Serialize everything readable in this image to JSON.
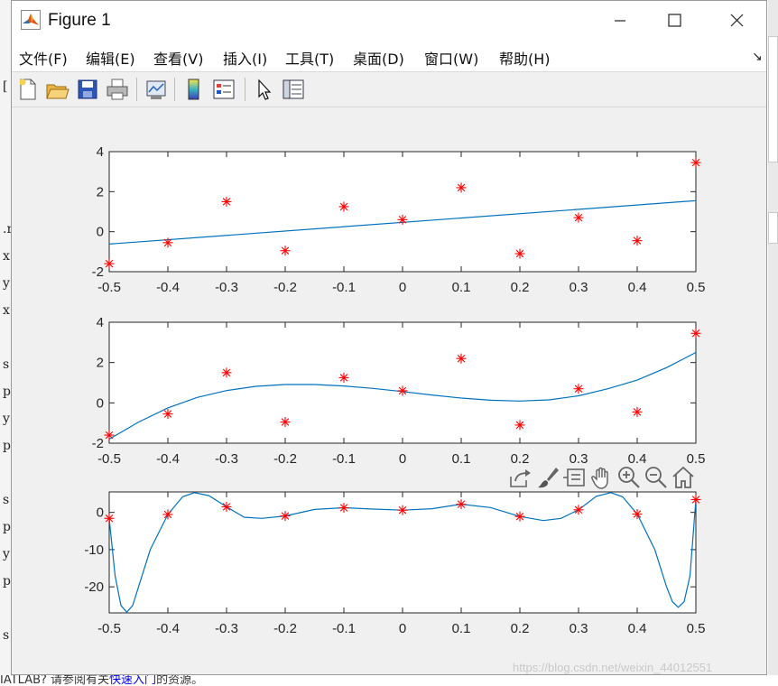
{
  "window": {
    "title": "Figure 1",
    "controls": {
      "minimize": "minimize",
      "maximize": "maximize",
      "close": "close"
    }
  },
  "menu": {
    "items": [
      "文件(F)",
      "编辑(E)",
      "查看(V)",
      "插入(I)",
      "工具(T)",
      "桌面(D)",
      "窗口(W)",
      "帮助(H)"
    ]
  },
  "toolbar": {
    "icons": [
      "new-figure-icon",
      "open-file-icon",
      "save-icon",
      "print-icon",
      "link-plot-icon",
      "colorbar-icon",
      "legend-icon",
      "edit-plot-arrow-icon",
      "property-inspector-icon"
    ]
  },
  "axes_toolbar": {
    "icons": [
      "export-icon",
      "brush-icon",
      "data-tips-icon",
      "pan-hand-icon",
      "zoom-in-icon",
      "zoom-out-icon",
      "home-icon"
    ]
  },
  "background": {
    "left_chars": [
      "[",
      ".r",
      "x",
      "y",
      "x",
      "s",
      "p",
      "y",
      "p",
      "s",
      "p",
      "y",
      "p",
      "s"
    ],
    "bottom_text_before": "IATLAB? 请参阅有关",
    "bottom_link": "快速入门",
    "bottom_text_after": "的资源。",
    "watermark": "https://blog.csdn.net/weixin_44012551"
  },
  "colors": {
    "line": "#0072bd",
    "marker": "#ff0000",
    "axes_bg": "#ffffff",
    "figure_bg": "#f0f0f0"
  },
  "chart_data": [
    {
      "type": "scatter",
      "fit": "linear",
      "x": [
        -0.5,
        -0.4,
        -0.3,
        -0.2,
        -0.1,
        0,
        0.1,
        0.2,
        0.3,
        0.4,
        0.5
      ],
      "y": [
        -1.6,
        -0.55,
        1.5,
        -0.95,
        1.25,
        0.6,
        2.2,
        -1.1,
        0.7,
        -0.45,
        3.45
      ],
      "line": {
        "x": [
          -0.5,
          0.5
        ],
        "y": [
          -0.62,
          1.55
        ]
      },
      "xlim": [
        -0.5,
        0.5
      ],
      "ylim": [
        -2,
        4
      ],
      "xticks": [
        "-0.5",
        "-0.4",
        "-0.3",
        "-0.2",
        "-0.1",
        "0",
        "0.1",
        "0.2",
        "0.3",
        "0.4",
        "0.5"
      ],
      "yticks": [
        "-2",
        "0",
        "2",
        "4"
      ]
    },
    {
      "type": "scatter",
      "fit": "cubic",
      "x": [
        -0.5,
        -0.4,
        -0.3,
        -0.2,
        -0.1,
        0,
        0.1,
        0.2,
        0.3,
        0.4,
        0.5
      ],
      "y": [
        -1.6,
        -0.55,
        1.5,
        -0.95,
        1.25,
        0.6,
        2.2,
        -1.1,
        0.7,
        -0.45,
        3.45
      ],
      "line": {
        "x": [
          -0.5,
          -0.45,
          -0.4,
          -0.35,
          -0.3,
          -0.25,
          -0.2,
          -0.15,
          -0.1,
          -0.05,
          0,
          0.05,
          0.1,
          0.15,
          0.2,
          0.25,
          0.3,
          0.35,
          0.4,
          0.45,
          0.5
        ],
        "y": [
          -1.8,
          -0.95,
          -0.25,
          0.27,
          0.61,
          0.82,
          0.91,
          0.91,
          0.84,
          0.72,
          0.56,
          0.39,
          0.24,
          0.13,
          0.09,
          0.15,
          0.35,
          0.7,
          1.13,
          1.75,
          2.5
        ]
      },
      "xlim": [
        -0.5,
        0.5
      ],
      "ylim": [
        -2,
        4
      ],
      "xticks": [
        "-0.5",
        "-0.4",
        "-0.3",
        "-0.2",
        "-0.1",
        "0",
        "0.1",
        "0.2",
        "0.3",
        "0.4",
        "0.5"
      ],
      "yticks": [
        "-2",
        "0",
        "2",
        "4"
      ]
    },
    {
      "type": "scatter",
      "fit": "interpolating polynomial (degree 10)",
      "x": [
        -0.5,
        -0.4,
        -0.3,
        -0.2,
        -0.1,
        0,
        0.1,
        0.2,
        0.3,
        0.4,
        0.5
      ],
      "y": [
        -1.6,
        -0.55,
        1.5,
        -0.95,
        1.25,
        0.6,
        2.2,
        -1.1,
        0.7,
        -0.45,
        3.45
      ],
      "line": {
        "x": [
          -0.5,
          -0.49,
          -0.48,
          -0.47,
          -0.46,
          -0.45,
          -0.43,
          -0.4,
          -0.375,
          -0.355,
          -0.33,
          -0.3,
          -0.27,
          -0.24,
          -0.2,
          -0.15,
          -0.1,
          -0.05,
          0,
          0.05,
          0.1,
          0.15,
          0.2,
          0.24,
          0.27,
          0.3,
          0.33,
          0.355,
          0.375,
          0.4,
          0.43,
          0.45,
          0.46,
          0.47,
          0.48,
          0.49,
          0.5
        ],
        "y": [
          -1.6,
          -17,
          -25,
          -26.8,
          -25,
          -20,
          -10,
          -0.55,
          4.2,
          5.3,
          4.5,
          1.5,
          -1.3,
          -1.6,
          -0.95,
          0.8,
          1.25,
          0.9,
          0.6,
          1.0,
          2.2,
          1.3,
          -1.1,
          -2.2,
          -1.6,
          0.7,
          4.3,
          5.3,
          4.2,
          -0.45,
          -10,
          -20,
          -24,
          -25.5,
          -24,
          -17,
          3.45
        ]
      },
      "xlim": [
        -0.5,
        0.5
      ],
      "ylim": [
        -27,
        5.5
      ],
      "xticks": [
        "-0.5",
        "-0.4",
        "-0.3",
        "-0.2",
        "-0.1",
        "0",
        "0.1",
        "0.2",
        "0.3",
        "0.4",
        "0.5"
      ],
      "yticks": [
        "-20",
        "-10",
        "0"
      ],
      "ytick_values": [
        -20,
        -10,
        0
      ]
    }
  ]
}
